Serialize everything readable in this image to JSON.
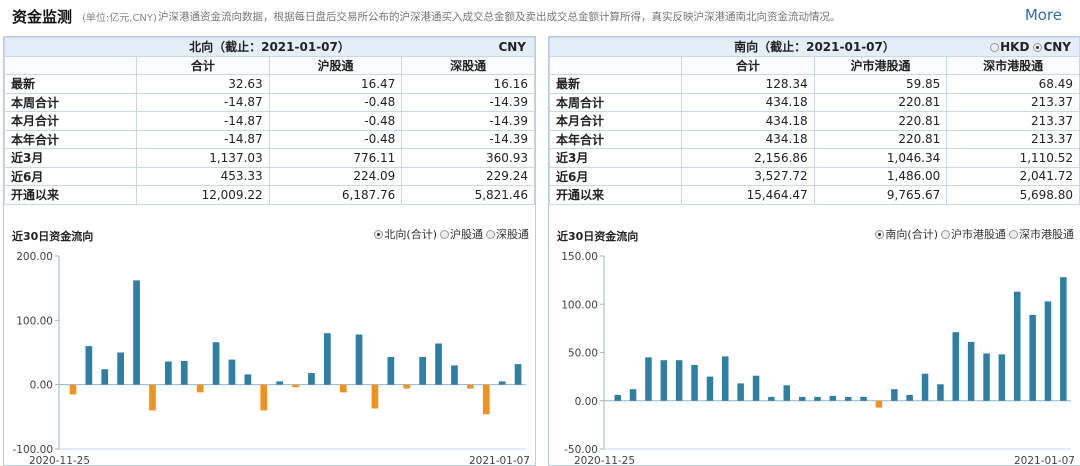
{
  "header": {
    "title": "资金监测",
    "unit": "(单位:亿元,CNY)",
    "description": "沪深港通资金流向数据，根据每日盘后交易所公布的沪深港通买入成交总金额及卖出成交总金额计算所得，真实反映沪深港通南北向资金流动情况。",
    "more": "More"
  },
  "north": {
    "title": "北向（截止：2021-01-07）",
    "currency": "CNY",
    "columns": [
      "合计",
      "沪股通",
      "深股通"
    ],
    "rows": [
      {
        "label": "最新",
        "values": [
          "32.63",
          "16.47",
          "16.16"
        ]
      },
      {
        "label": "本周合计",
        "values": [
          "-14.87",
          "-0.48",
          "-14.39"
        ]
      },
      {
        "label": "本月合计",
        "values": [
          "-14.87",
          "-0.48",
          "-14.39"
        ]
      },
      {
        "label": "本年合计",
        "values": [
          "-14.87",
          "-0.48",
          "-14.39"
        ]
      },
      {
        "label": "近3月",
        "values": [
          "1,137.03",
          "776.11",
          "360.93"
        ]
      },
      {
        "label": "近6月",
        "values": [
          "453.33",
          "224.09",
          "229.24"
        ]
      },
      {
        "label": "开通以来",
        "values": [
          "12,009.22",
          "6,187.76",
          "5,821.46"
        ]
      }
    ],
    "chart_title": "近30日资金流向",
    "legend": [
      "北向(合计)",
      "沪股通",
      "深股通"
    ],
    "legend_selected": 0
  },
  "south": {
    "title": "南向（截止：2021-01-07）",
    "currency_options": [
      "HKD",
      "CNY"
    ],
    "currency_selected": 1,
    "columns": [
      "合计",
      "沪市港股通",
      "深市港股通"
    ],
    "rows": [
      {
        "label": "最新",
        "values": [
          "128.34",
          "59.85",
          "68.49"
        ]
      },
      {
        "label": "本周合计",
        "values": [
          "434.18",
          "220.81",
          "213.37"
        ]
      },
      {
        "label": "本月合计",
        "values": [
          "434.18",
          "220.81",
          "213.37"
        ]
      },
      {
        "label": "本年合计",
        "values": [
          "434.18",
          "220.81",
          "213.37"
        ]
      },
      {
        "label": "近3月",
        "values": [
          "2,156.86",
          "1,046.34",
          "1,110.52"
        ]
      },
      {
        "label": "近6月",
        "values": [
          "3,527.72",
          "1,486.00",
          "2,041.72"
        ]
      },
      {
        "label": "开通以来",
        "values": [
          "15,464.47",
          "9,765.67",
          "5,698.80"
        ]
      }
    ],
    "chart_title": "近30日资金流向",
    "legend": [
      "南向(合计)",
      "沪市港股通",
      "深市港股通"
    ],
    "legend_selected": 0
  },
  "colors": {
    "positive": "#2e7ea6",
    "negative": "#f0931e",
    "header_bg": "#e4eef9",
    "border": "#c9d7e8",
    "link": "#2f6db5"
  },
  "chart_data": [
    {
      "type": "bar",
      "title": "近30日资金流向",
      "x_tick_labels": [
        "2020-11-25",
        "2021-01-07"
      ],
      "y_tick_labels": [
        "200.00",
        "100.00",
        "0.00",
        "-100.00"
      ],
      "ylim": [
        -100,
        200
      ],
      "values": [
        -15,
        60,
        24,
        50,
        162,
        -40,
        36,
        37,
        -12,
        66,
        39,
        16,
        -40,
        5,
        -4,
        18,
        80,
        -12,
        78,
        -37,
        43,
        -6,
        43,
        64,
        30,
        -6,
        -46,
        5,
        32
      ],
      "grid": false,
      "legend_position": "top-right"
    },
    {
      "type": "bar",
      "title": "近30日资金流向",
      "x_tick_labels": [
        "2020-11-25",
        "2021-01-07"
      ],
      "y_tick_labels": [
        "150.00",
        "100.00",
        "50.00",
        "0.00",
        "-50.00"
      ],
      "ylim": [
        -50,
        150
      ],
      "values": [
        6,
        12,
        45,
        42,
        42,
        37,
        25,
        46,
        18,
        26,
        4,
        16,
        4,
        4,
        5,
        4,
        4,
        -7,
        12,
        6,
        28,
        17,
        71,
        61,
        49,
        48,
        113,
        89,
        103,
        128
      ],
      "grid": false,
      "legend_position": "top-right"
    }
  ]
}
